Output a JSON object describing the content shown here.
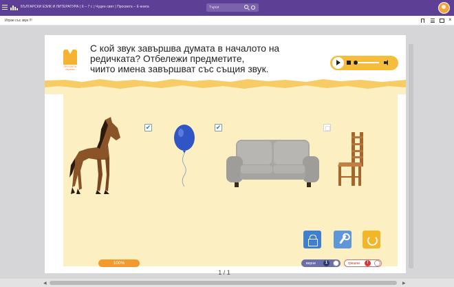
{
  "topbar": {
    "title": "БЪЛГАРСКИ ЕЗИК И ЛИТЕРАТУРА | 6 – 7 г. | Чуден свят | Просвета – Е-книга",
    "search_placeholder": "Търси"
  },
  "subbar": {
    "title": "Играе със звук !!!"
  },
  "exercise": {
    "logo_text": "ПРОСВЕТА Играчки",
    "question_lines": [
      "С кой звук завършва думата в началото на",
      "редичката? Отбележи предметите,",
      "чиито имена завършват със същия звук."
    ],
    "items": [
      {
        "name": "horse",
        "checked": true
      },
      {
        "name": "balloon",
        "checked": true
      },
      {
        "name": "sofa",
        "checked": false
      },
      {
        "name": "chair",
        "checked": false
      }
    ],
    "check_mark": "✔",
    "progress_label": "100%",
    "pager": "1 / 1",
    "correct_label": "верни",
    "correct_count": "1",
    "wrong_label": "грешни",
    "wrong_count": "!"
  },
  "colors": {
    "topbar": "#5d3f95",
    "panel": "#fcefc2",
    "accent_yellow": "#f5b233",
    "action_blue": "#3e7fcf",
    "progress_orange": "#f29a2e"
  },
  "icons": [
    "menu-icon",
    "brand-icon",
    "search-icon",
    "gear-icon",
    "avatar",
    "bookmark-icon",
    "list-icon",
    "panel-icon",
    "close-icon",
    "play-icon",
    "stop-icon",
    "volume-icon",
    "lock-icon",
    "tool-icon",
    "reset-icon"
  ]
}
